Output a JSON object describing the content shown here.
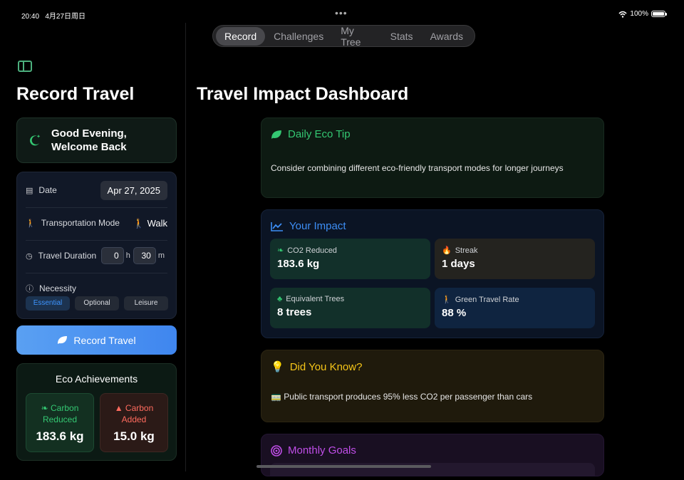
{
  "status_bar": {
    "time": "20:40",
    "date": "4月27日周日",
    "battery": "100%"
  },
  "tabs": [
    {
      "label": "Record",
      "active": true
    },
    {
      "label": "Challenges",
      "active": false
    },
    {
      "label": "My Tree",
      "active": false
    },
    {
      "label": "Stats",
      "active": false
    },
    {
      "label": "Awards",
      "active": false
    }
  ],
  "sidebar": {
    "title": "Record Travel",
    "greeting": {
      "line1": "Good Evening,",
      "line2": "Welcome Back",
      "icon": "moon-icon"
    },
    "form": {
      "date_label": "Date",
      "date_value": "Apr 27, 2025",
      "mode_label": "Transportation Mode",
      "mode_value": "Walk",
      "duration_label": "Travel Duration",
      "hours": "0",
      "hours_unit": "h",
      "minutes": "30",
      "minutes_unit": "m",
      "necessity_label": "Necessity",
      "necessity_options": [
        "Essential",
        "Optional",
        "Leisure"
      ],
      "necessity_selected": "Essential"
    },
    "record_button": "Record Travel",
    "achievements": {
      "title": "Eco Achievements",
      "carbon_reduced_label1": "Carbon",
      "carbon_reduced_label2": "Reduced",
      "carbon_reduced_value": "183.6 kg",
      "carbon_added_label1": "Carbon",
      "carbon_added_label2": "Added",
      "carbon_added_value": "15.0 kg"
    }
  },
  "main": {
    "title": "Travel Impact Dashboard",
    "tip": {
      "title": "Daily Eco Tip",
      "text": "Consider combining different eco-friendly transport modes for longer journeys"
    },
    "impact": {
      "title": "Your Impact",
      "co2_label": "CO2 Reduced",
      "co2_value": "183.6 kg",
      "streak_label": "Streak",
      "streak_value": "1 days",
      "trees_label": "Equivalent Trees",
      "trees_value": "8 trees",
      "green_label": "Green Travel Rate",
      "green_value": "88 %"
    },
    "know": {
      "title": "Did You Know?",
      "text": "Public transport produces 95% less CO2 per passenger than cars"
    },
    "goals": {
      "title": "Monthly Goals"
    }
  },
  "colors": {
    "green": "#34c772",
    "blue": "#3d8ef5",
    "yellow": "#f5c518",
    "purple": "#c04ee8",
    "red": "#ff6b5e"
  }
}
